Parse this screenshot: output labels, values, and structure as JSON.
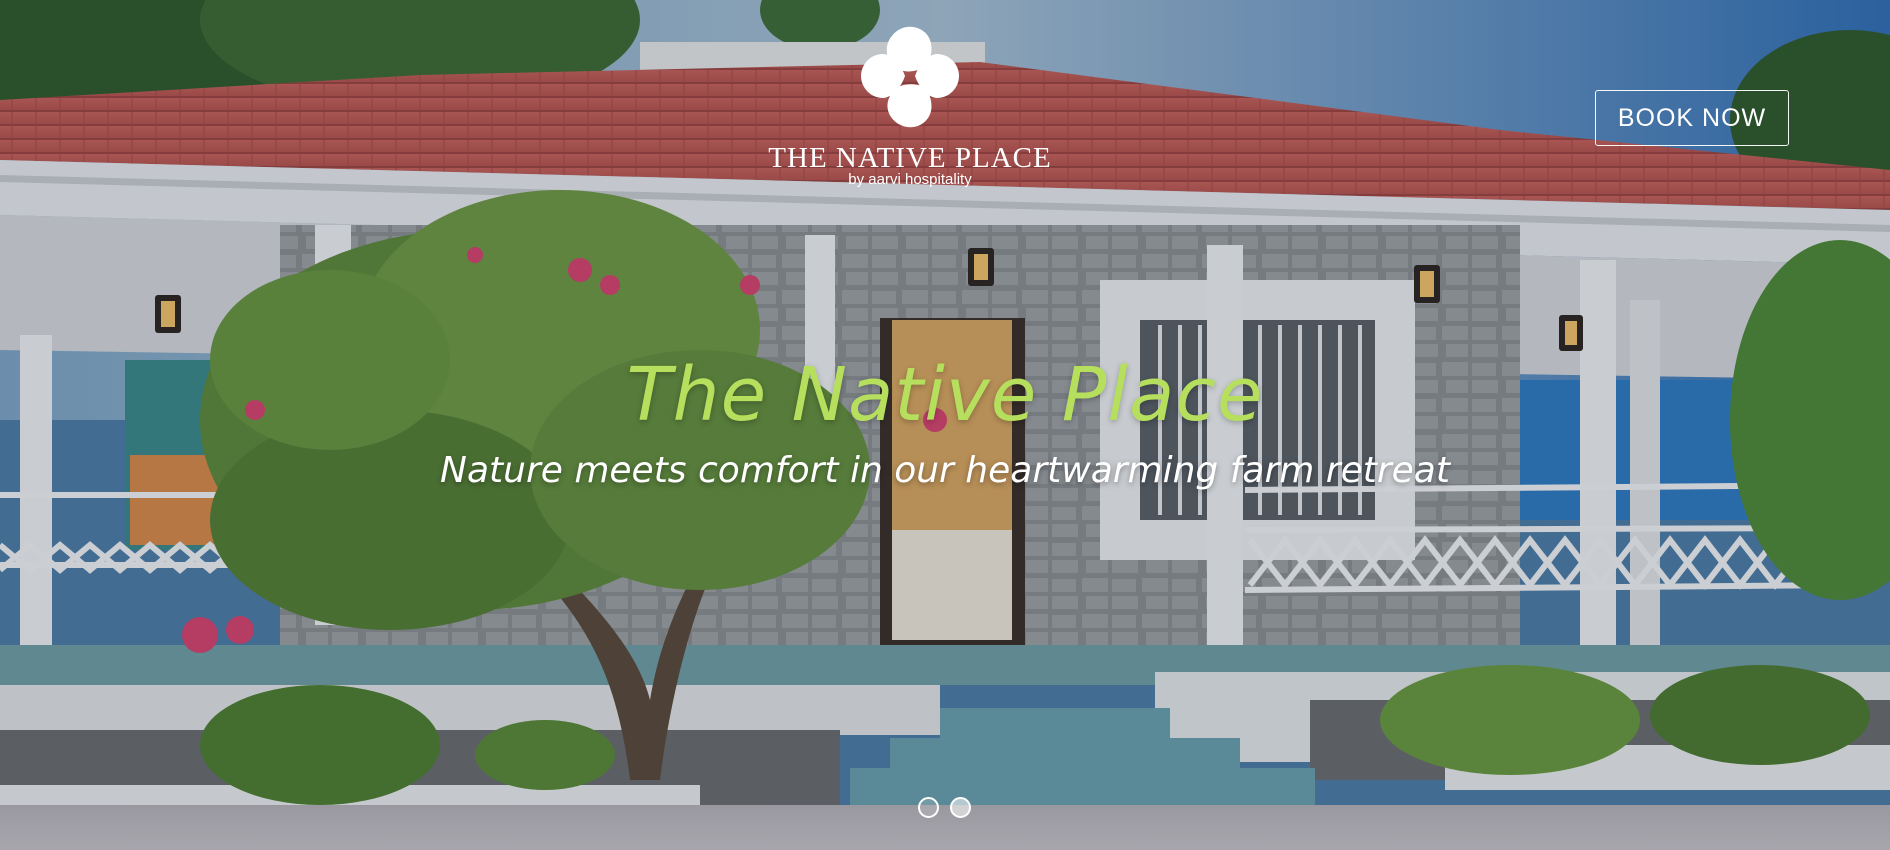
{
  "brand": {
    "name": "THE NATIVE PLACE",
    "subtitle": "by aarvi hospitality"
  },
  "nav": {
    "book_now_label": "BOOK NOW"
  },
  "hero": {
    "title": "The Native Place",
    "tagline": "Nature meets comfort in our heartwarming farm retreat"
  },
  "carousel": {
    "slide_count": 2,
    "active_index": 1
  },
  "colors": {
    "title_green": "#b6df5e",
    "white": "#ffffff",
    "roof_red": "#c95a52",
    "sky_blue": "#4d7da8"
  },
  "icons": {
    "logo": "four-petal-logo-icon"
  }
}
